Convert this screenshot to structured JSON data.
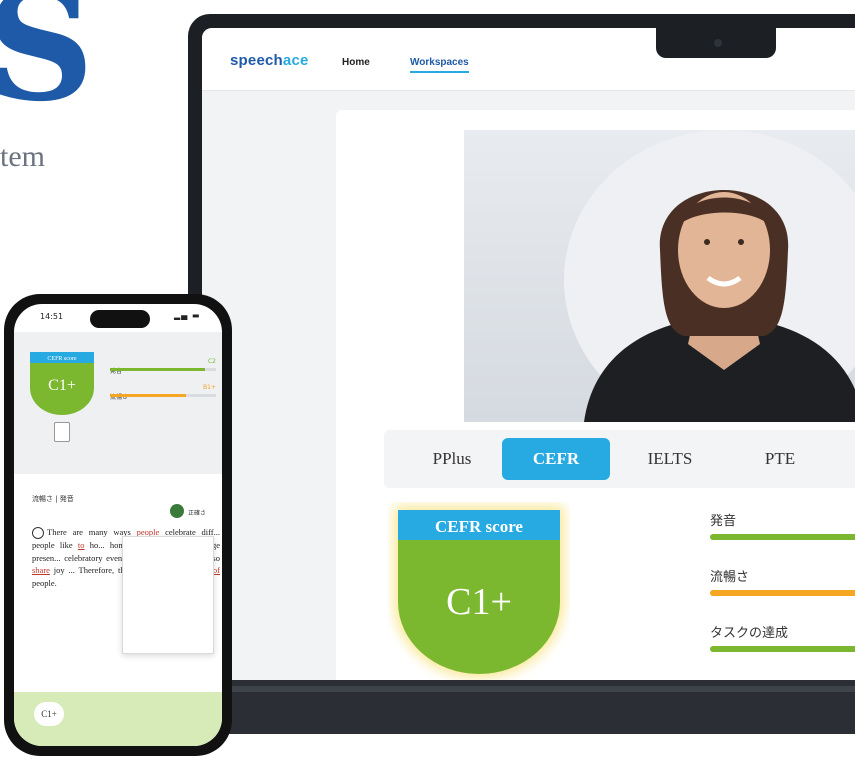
{
  "brand_logo": {
    "letter": "S",
    "text": "tem"
  },
  "laptop": {
    "app": {
      "brand_prefix": "speech",
      "brand_accent": "ace"
    },
    "nav": {
      "home": "Home",
      "workspaces": "Workspaces"
    },
    "tabs": [
      {
        "label": "PPlus",
        "active": false
      },
      {
        "label": "CEFR",
        "active": true
      },
      {
        "label": "IELTS",
        "active": false
      },
      {
        "label": "PTE",
        "active": false
      }
    ],
    "score": {
      "title": "CEFR score",
      "value": "C1+"
    },
    "metrics": [
      {
        "label": "発音",
        "color": "#7cb82f",
        "fill": 1.0
      },
      {
        "label": "流暢さ",
        "color": "#f5a623",
        "fill": 1.0
      },
      {
        "label": "タスクの達成",
        "color": "#7cb82f",
        "fill": 1.0
      }
    ],
    "colors": {
      "accent": "#27a9e1",
      "brand": "#1f5aa8",
      "green": "#7cb82f",
      "orange": "#f5a623"
    }
  },
  "phone": {
    "time": "14:51",
    "score": {
      "title": "CEFR score",
      "value": "C1+"
    },
    "metrics": [
      {
        "label": "発音",
        "value": "C2",
        "color": "#7cb82f",
        "fill": 0.9
      },
      {
        "label": "流暢さ",
        "value": "B1+",
        "color": "#f5a623",
        "fill": 0.72
      }
    ],
    "section_title": "流暢さ | 発音",
    "badge_label": "正確さ",
    "bottom_score": "C1+"
  }
}
